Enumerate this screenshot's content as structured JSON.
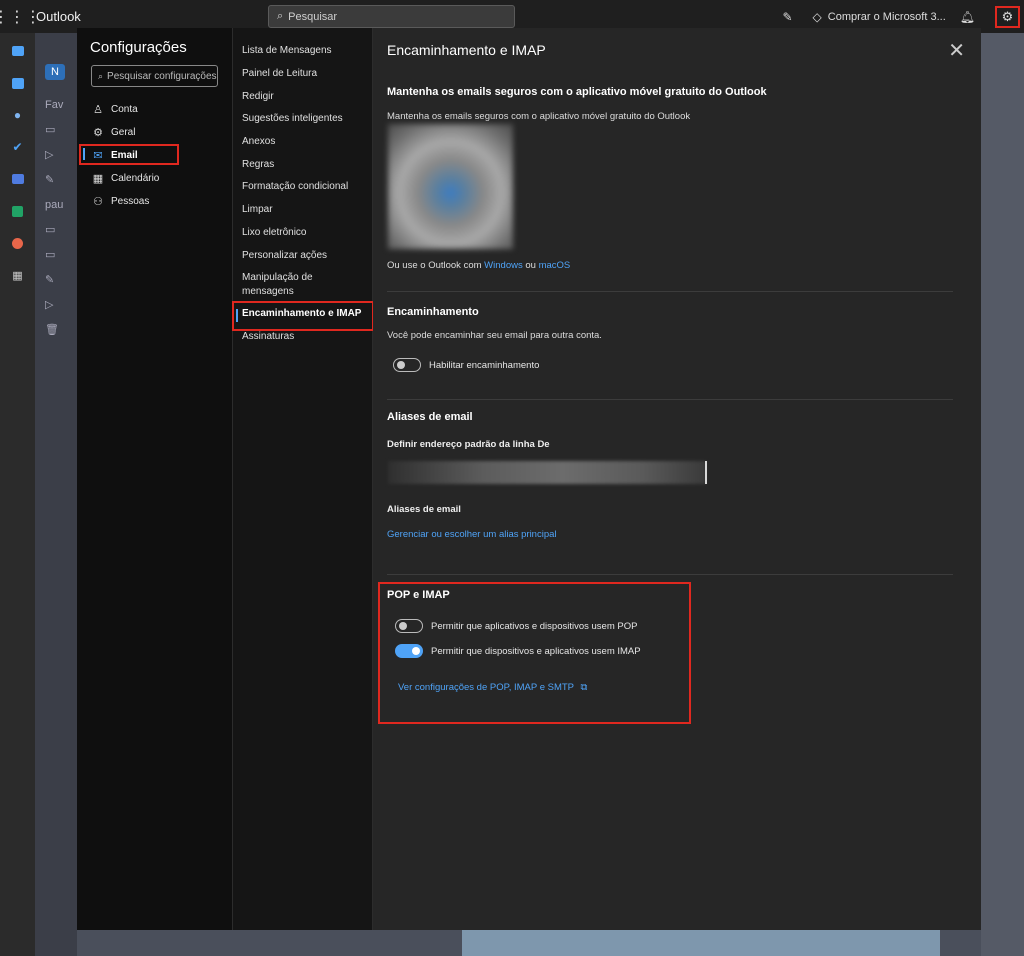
{
  "topbar": {
    "app_name": "Outlook",
    "search_placeholder": "Pesquisar",
    "buy_label": "Comprar o Microsoft 3...",
    "icons": [
      "app-launcher-icon",
      "search-icon",
      "note-icon",
      "diamond-icon",
      "bell-icon",
      "gear-icon"
    ]
  },
  "rail": {
    "icons": [
      "mail-icon",
      "calendar-icon",
      "people-icon",
      "todo-icon",
      "groups-icon",
      "excel-icon",
      "powerpoint-icon",
      "apps-icon"
    ]
  },
  "background": {
    "new_label": "N",
    "favorites_label": "Fav",
    "account_label": "pau"
  },
  "settings": {
    "title": "Configurações",
    "search_placeholder": "Pesquisar configurações",
    "nav": [
      {
        "label": "Conta",
        "icon": "person-icon"
      },
      {
        "label": "Geral",
        "icon": "gear-icon"
      },
      {
        "label": "Email",
        "icon": "mail-icon",
        "active": true
      },
      {
        "label": "Calendário",
        "icon": "calendar-icon"
      },
      {
        "label": "Pessoas",
        "icon": "people-icon"
      }
    ],
    "subnav": [
      "Lista de Mensagens",
      "Painel de Leitura",
      "Redigir",
      "Sugestões inteligentes",
      "Anexos",
      "Regras",
      "Formatação condicional",
      "Limpar",
      "Lixo eletrônico",
      "Personalizar ações",
      "Manipulação de mensagens",
      "Encaminhamento e IMAP",
      "Assinaturas"
    ],
    "subnav_active": "Encaminhamento e IMAP"
  },
  "panel": {
    "title": "Encaminhamento e IMAP",
    "mobile": {
      "heading": "Mantenha os emails seguros com o aplicativo móvel gratuito do Outlook",
      "subtext": "Mantenha os emails seguros com o aplicativo móvel gratuito do Outlook",
      "also_prefix": "Ou use o Outlook com",
      "windows_link": "Windows",
      "or_word": "ou",
      "macos_link": "macOS"
    },
    "forwarding": {
      "heading": "Encaminhamento",
      "description": "Você pode encaminhar seu email para outra conta.",
      "toggle_label": "Habilitar encaminhamento",
      "enabled": false
    },
    "aliases": {
      "heading": "Aliases de email",
      "from_label": "Definir endereço padrão da linha De",
      "aliases_label": "Aliases de email",
      "manage_link": "Gerenciar ou escolher um alias principal"
    },
    "pop_imap": {
      "heading": "POP e IMAP",
      "pop_label": "Permitir que aplicativos e dispositivos usem POP",
      "pop_enabled": false,
      "imap_label": "Permitir que dispositivos e aplicativos usem IMAP",
      "imap_enabled": true,
      "settings_link": "Ver configurações de POP, IMAP e SMTP"
    }
  },
  "colors": {
    "accent": "#4fa3f7",
    "highlight": "#e0281f",
    "dialog_bg": "#262626"
  }
}
